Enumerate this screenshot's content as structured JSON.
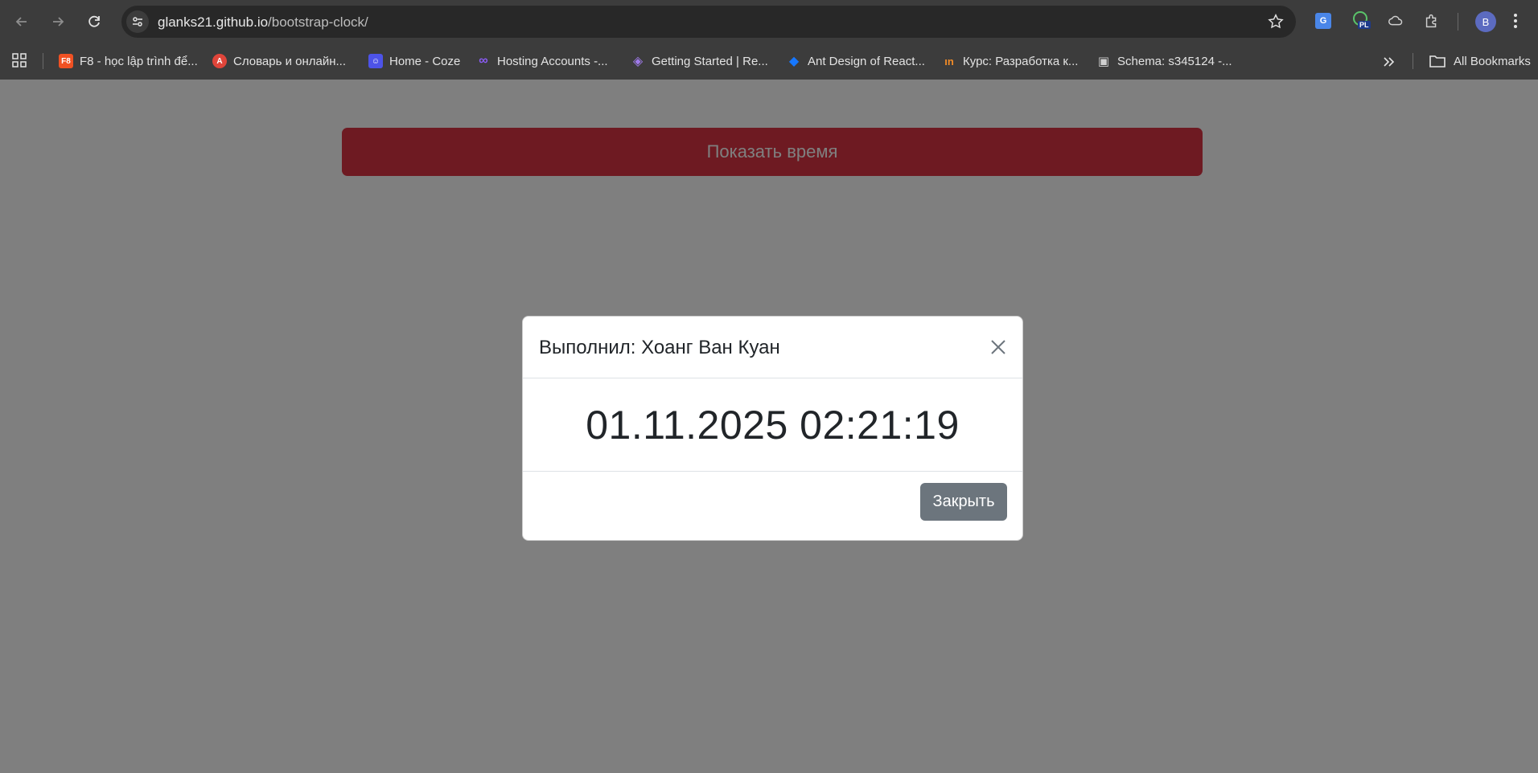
{
  "browser": {
    "url_host": "glanks21.github.io",
    "url_path": "/bootstrap-clock/",
    "profile_initial": "B",
    "extensions": [
      "google-translate-icon",
      "pl-debugger-icon",
      "cloud-icon",
      "puzzle-icon"
    ]
  },
  "bookmarks": {
    "items": [
      {
        "label": "F8 - học lập trình để...",
        "icon": "F8",
        "color": "#f05123"
      },
      {
        "label": "Словарь и онлайн...",
        "icon": "A",
        "color": "#e0453a"
      },
      {
        "label": "Home - Coze",
        "icon": "☺",
        "color": "#4d53e8"
      },
      {
        "label": "Hosting Accounts -...",
        "icon": "∞",
        "color": "#7b4cf0"
      },
      {
        "label": "Getting Started | Re...",
        "icon": "◈",
        "color": "#764abc"
      },
      {
        "label": "Ant Design of React...",
        "icon": "◆",
        "color": "#1677ff"
      },
      {
        "label": "Курс: Разработка к...",
        "icon": "ın",
        "color": "#f28c28"
      },
      {
        "label": "Schema: s345124 -...",
        "icon": "▣",
        "color": "#9e9e9e"
      }
    ],
    "all_label": "All Bookmarks"
  },
  "page": {
    "show_button_label": "Показать время"
  },
  "modal": {
    "title": "Выполнил: Хоанг Ван Куан",
    "datetime": "01.11.2025 02:21:19",
    "close_button_label": "Закрыть"
  },
  "colors": {
    "danger": "#dc3545",
    "secondary": "#6c757d",
    "chrome_bg": "#3c3c3c"
  }
}
